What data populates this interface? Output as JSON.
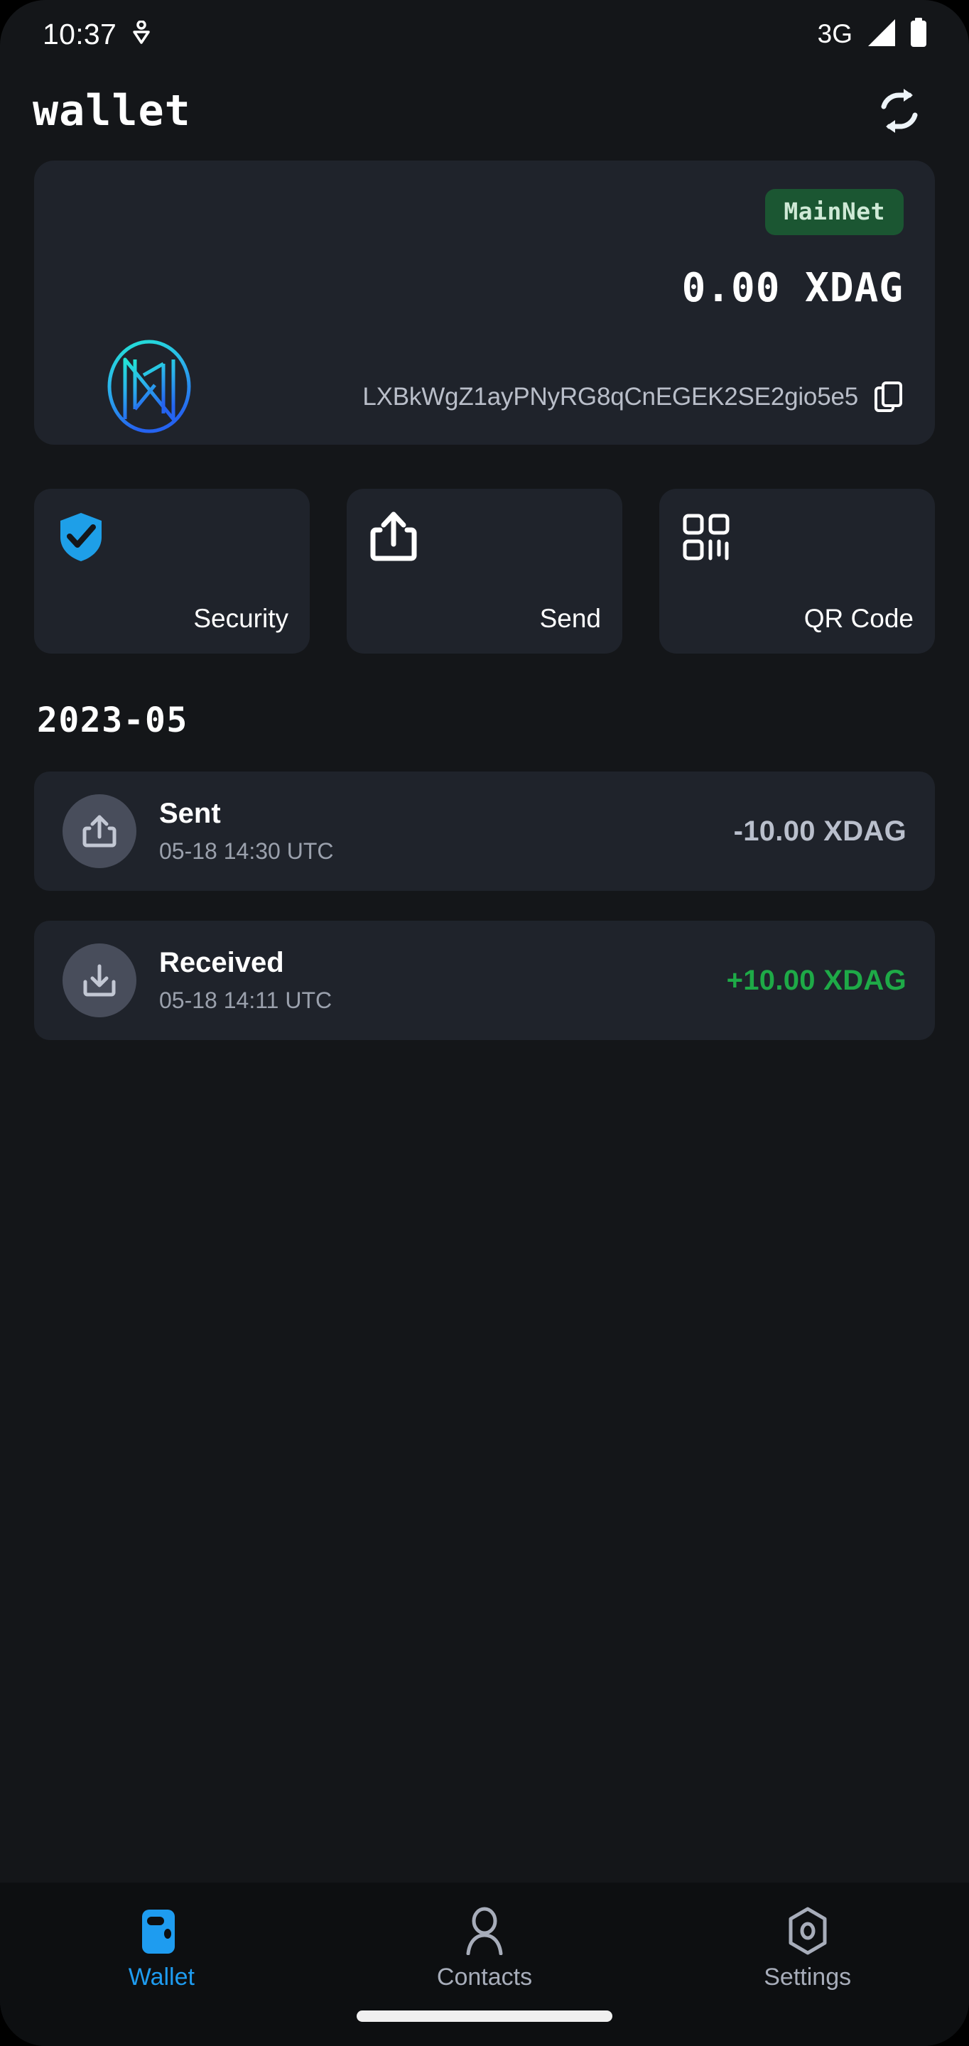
{
  "status_bar": {
    "clock": "10:37",
    "location_icon": "location-pin-icon",
    "network_type": "3G",
    "signal_icon": "signal-bars-icon",
    "battery_icon": "battery-full-icon"
  },
  "header": {
    "title": "wallet",
    "refresh_icon": "refresh-sync-icon"
  },
  "balance_card": {
    "logo_icon": "xdag-logo-icon",
    "network_badge": "MainNet",
    "balance": "0.00 XDAG",
    "address": "LXBkWgZ1ayPNyRG8qCnEGEK2SE2gio5e5",
    "copy_icon": "copy-icon"
  },
  "actions": [
    {
      "label": "Security",
      "icon": "shield-check-icon"
    },
    {
      "label": "Send",
      "icon": "share-upload-icon"
    },
    {
      "label": "QR Code",
      "icon": "qr-code-icon"
    }
  ],
  "transactions_section": {
    "month": "2023-05",
    "items": [
      {
        "title": "Sent",
        "time": "05-18 14:30  UTC",
        "amount": "-10.00 XDAG",
        "direction": "negative",
        "icon": "upload-arrow-icon"
      },
      {
        "title": "Received",
        "time": "05-18 14:11  UTC",
        "amount": "+10.00 XDAG",
        "direction": "positive",
        "icon": "download-arrow-icon"
      }
    ]
  },
  "bottom_nav": [
    {
      "label": "Wallet",
      "icon": "wallet-icon",
      "active": true
    },
    {
      "label": "Contacts",
      "icon": "person-icon",
      "active": false
    },
    {
      "label": "Settings",
      "icon": "gear-hexagon-icon",
      "active": false
    }
  ],
  "colors": {
    "page_background": "#141619",
    "card_background": "#1f232b",
    "accent_blue": "#1e9cf0",
    "positive_green": "#1eaa47",
    "badge_green_bg": "#1b5632",
    "badge_green_text": "#cfe9d6",
    "muted_text": "#9ba1ad"
  }
}
